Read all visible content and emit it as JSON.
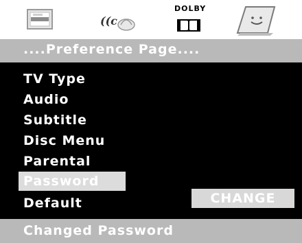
{
  "icons": [
    {
      "name": "tv-screen-icon"
    },
    {
      "name": "audio-speaker-icon"
    },
    {
      "name": "dolby-icon",
      "label": "DOLBY"
    },
    {
      "name": "preference-icon"
    }
  ],
  "header": {
    "title": "....Preference Page...."
  },
  "menu": {
    "items": [
      {
        "label": "TV Type"
      },
      {
        "label": "Audio"
      },
      {
        "label": "Subtitle"
      },
      {
        "label": "Disc Menu"
      },
      {
        "label": "Parental"
      },
      {
        "label": "Password",
        "selected": true
      },
      {
        "label": "Default"
      }
    ],
    "change_label": "CHANGE"
  },
  "status": {
    "text": "Changed Password"
  },
  "colors": {
    "background": "#000000",
    "header_bar": "#b9b9b9",
    "highlight": "#dcdcdc",
    "text": "#ffffff"
  }
}
